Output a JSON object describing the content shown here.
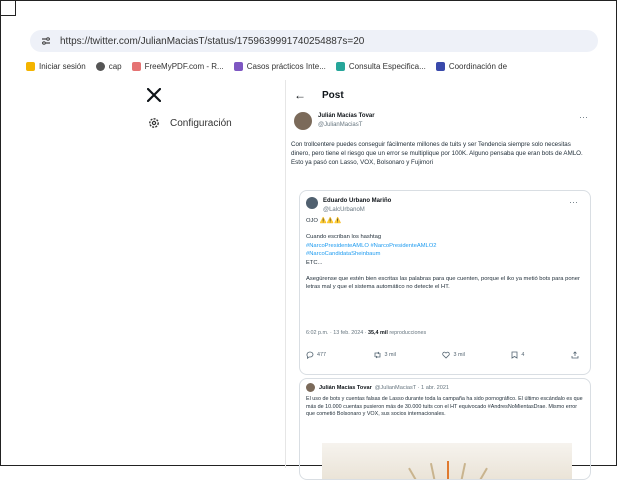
{
  "browser": {
    "url": "https://twitter.com/JulianMaciasT/status/1759639991740254887s=20",
    "bookmarks": [
      {
        "label": "Iniciar sesión",
        "icon": "document-icon",
        "color": "#f4b400"
      },
      {
        "label": "cap",
        "icon": "globe-icon",
        "color": "#555555"
      },
      {
        "label": "FreeMyPDF.com - R...",
        "icon": "pdf-icon",
        "color": "#e57373"
      },
      {
        "label": "Casos prácticos Inte...",
        "icon": "bookmark-icon",
        "color": "#7e57c2"
      },
      {
        "label": "Consulta Especifica...",
        "icon": "bookmark-icon",
        "color": "#26a69a"
      },
      {
        "label": "Coordinación de",
        "icon": "bookmark-icon",
        "color": "#3949ab"
      }
    ]
  },
  "sidebar": {
    "logo": "x-logo-icon",
    "settings_label": "Configuración"
  },
  "post": {
    "header": "Post",
    "author_name": "Julián Macías Tovar",
    "author_handle": "@JulianMaciasT",
    "text": "Con trollcentere puedes conseguir fácilmente millones de tuits y ser Tendencia siempre solo necesitas dinero, pero tiene el riesgo que un error se multiplique por 100K. Alguno pensaba que eran bots de AMLO. Esto ya pasó con Lasso, VOX, Bolsonaro y Fujimori"
  },
  "quote": {
    "author_name": "Eduardo Urbano Mariño",
    "author_handle": "@LalcUrbanoM",
    "line1": "OJO ⚠️⚠️⚠️",
    "line2": "Cuando escriban los hashtag",
    "tag1": "#NarcoPresidenteAMLO #NarcoPresidenteAMLO2",
    "tag2": "#NarcoCandidataSheinbaum",
    "line3": "ETC...",
    "warning": "Asegúrense que estén bien escritas las palabras para que cuenten, porque el iko ya metió bots para poner letras mal y que el sistema automático no detecte el HT.",
    "meta_time": "6:02 p.m. · 13 feb. 2024 ·",
    "meta_views": "35,4 mil",
    "meta_label": "reproducciones",
    "replies": "477",
    "reposts": "3 mil",
    "likes": "3 mil",
    "bookmarks": "4"
  },
  "card2": {
    "author_name": "Julián Macías Tovar",
    "author_handle": "@JulianMaciasT · 1 abr. 2021",
    "text": "El uso de bots y cuentas falsas de Lasso durante toda la campaña ha sido pornográfico. El último escándalo es que más de 10.000 cuentas pusieron más de 30.000 tuits con el HT equivocado #AndresNoMientasDrae. Mismo error que cometió Bolsonaro y VOX, sus socios internacionales."
  }
}
